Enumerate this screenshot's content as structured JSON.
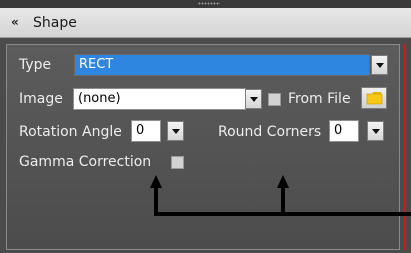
{
  "panel": {
    "title": "Shape"
  },
  "fields": {
    "type_label": "Type",
    "type_value": "RECT",
    "image_label": "Image",
    "image_value": "(none)",
    "from_file_label": "From File",
    "rotation_label": "Rotation Angle",
    "rotation_value": "0",
    "round_corners_label": "Round Corners",
    "round_corners_value": "0",
    "gamma_label": "Gamma Correction"
  },
  "state": {
    "from_file_checked": false,
    "gamma_checked": false
  },
  "icons": {
    "collapse": "double-chevron-down-icon",
    "folder": "folder-icon",
    "dropdown": "dropdown-arrow-icon"
  },
  "colors": {
    "panel_bg": "#4f4f4f",
    "selection": "#2f86e0",
    "annotation_arrows": "#000000"
  }
}
